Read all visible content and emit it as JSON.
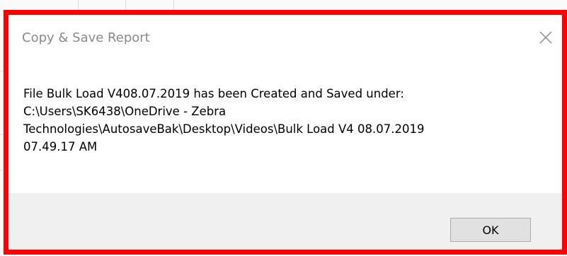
{
  "dialog": {
    "title": "Copy & Save Report",
    "message": "File Bulk Load V408.07.2019 has been Created and Saved under:\nC:\\Users\\SK6438\\OneDrive - Zebra\nTechnologies\\AutosaveBak\\Desktop\\Videos\\Bulk Load V4 08.07.2019\n07.49.17 AM",
    "ok_label": "OK",
    "close_icon": "close-icon"
  },
  "colors": {
    "highlight_border": "#ff0000",
    "title_text": "#8a8a8a",
    "footer_bg": "#f0f0f0",
    "button_bg": "#e1e1e1"
  }
}
